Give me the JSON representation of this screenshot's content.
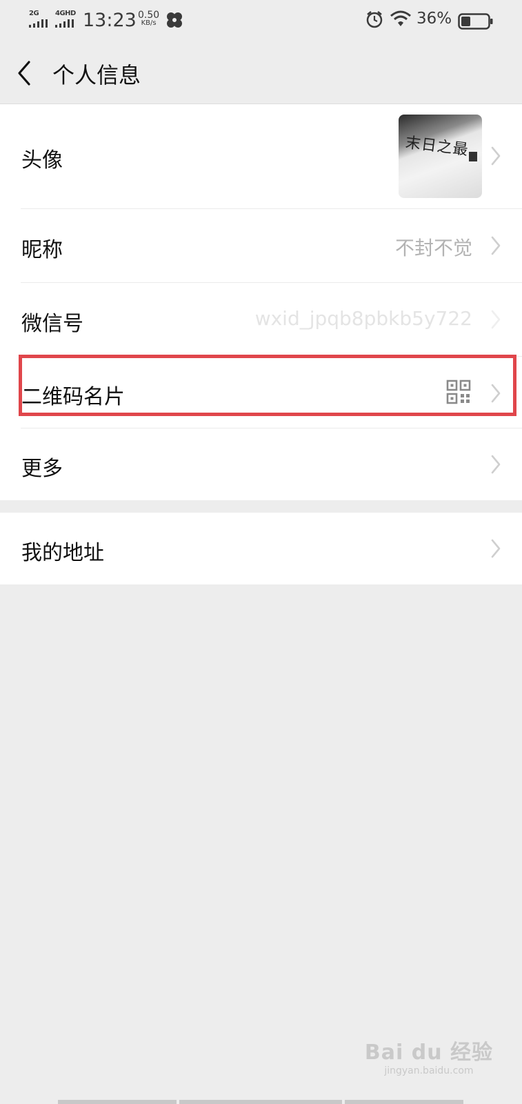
{
  "status_bar": {
    "sim1": "2G",
    "sim2": "4GHD",
    "time": "13:23",
    "net_speed": "0.50",
    "net_unit": "KB/s",
    "battery_percent": "36%",
    "battery_level": 0.36
  },
  "nav": {
    "back_icon": "chevron-left-icon",
    "title": "个人信息"
  },
  "rows": {
    "avatar": {
      "label": "头像"
    },
    "nickname": {
      "label": "昵称",
      "value": "不封不觉"
    },
    "wechat_id": {
      "label": "微信号",
      "value": "wxid_jpqb8pbkb5y722"
    },
    "qr_card": {
      "label": "二维码名片",
      "icon": "qr-code-icon"
    },
    "more": {
      "label": "更多"
    },
    "address": {
      "label": "我的地址"
    }
  },
  "avatar_text": "末日之最",
  "watermark": {
    "brand": "Bai du 经验",
    "site": "jingyan.baidu.com"
  },
  "colors": {
    "background": "#ededed",
    "card": "#ffffff",
    "highlight_border": "#e0464b",
    "muted_text": "#b3b3b3"
  }
}
